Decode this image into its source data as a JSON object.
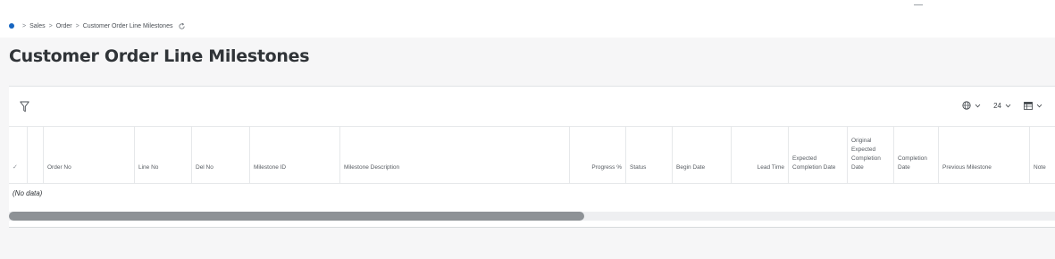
{
  "breadcrumb": {
    "items": [
      "Sales",
      "Order",
      "Customer Order Line Milestones"
    ],
    "separator": ">"
  },
  "page": {
    "title": "Customer Order Line Milestones"
  },
  "toolbar": {
    "page_size": "24"
  },
  "grid": {
    "columns": [
      "Order No",
      "Line No",
      "Del No",
      "Milestone ID",
      "Milestone Description",
      "Progress %",
      "Status",
      "Begin Date",
      "Lead Time",
      "Expected Completion Date",
      "Original Expected Completion Date",
      "Completion Date",
      "Previous Milestone",
      "Note"
    ],
    "empty_text": "(No data)",
    "horizontal_scroll_fraction": 0.55
  },
  "colors": {
    "accent": "#1565c0",
    "scroll_thumb": "#8e9296"
  }
}
